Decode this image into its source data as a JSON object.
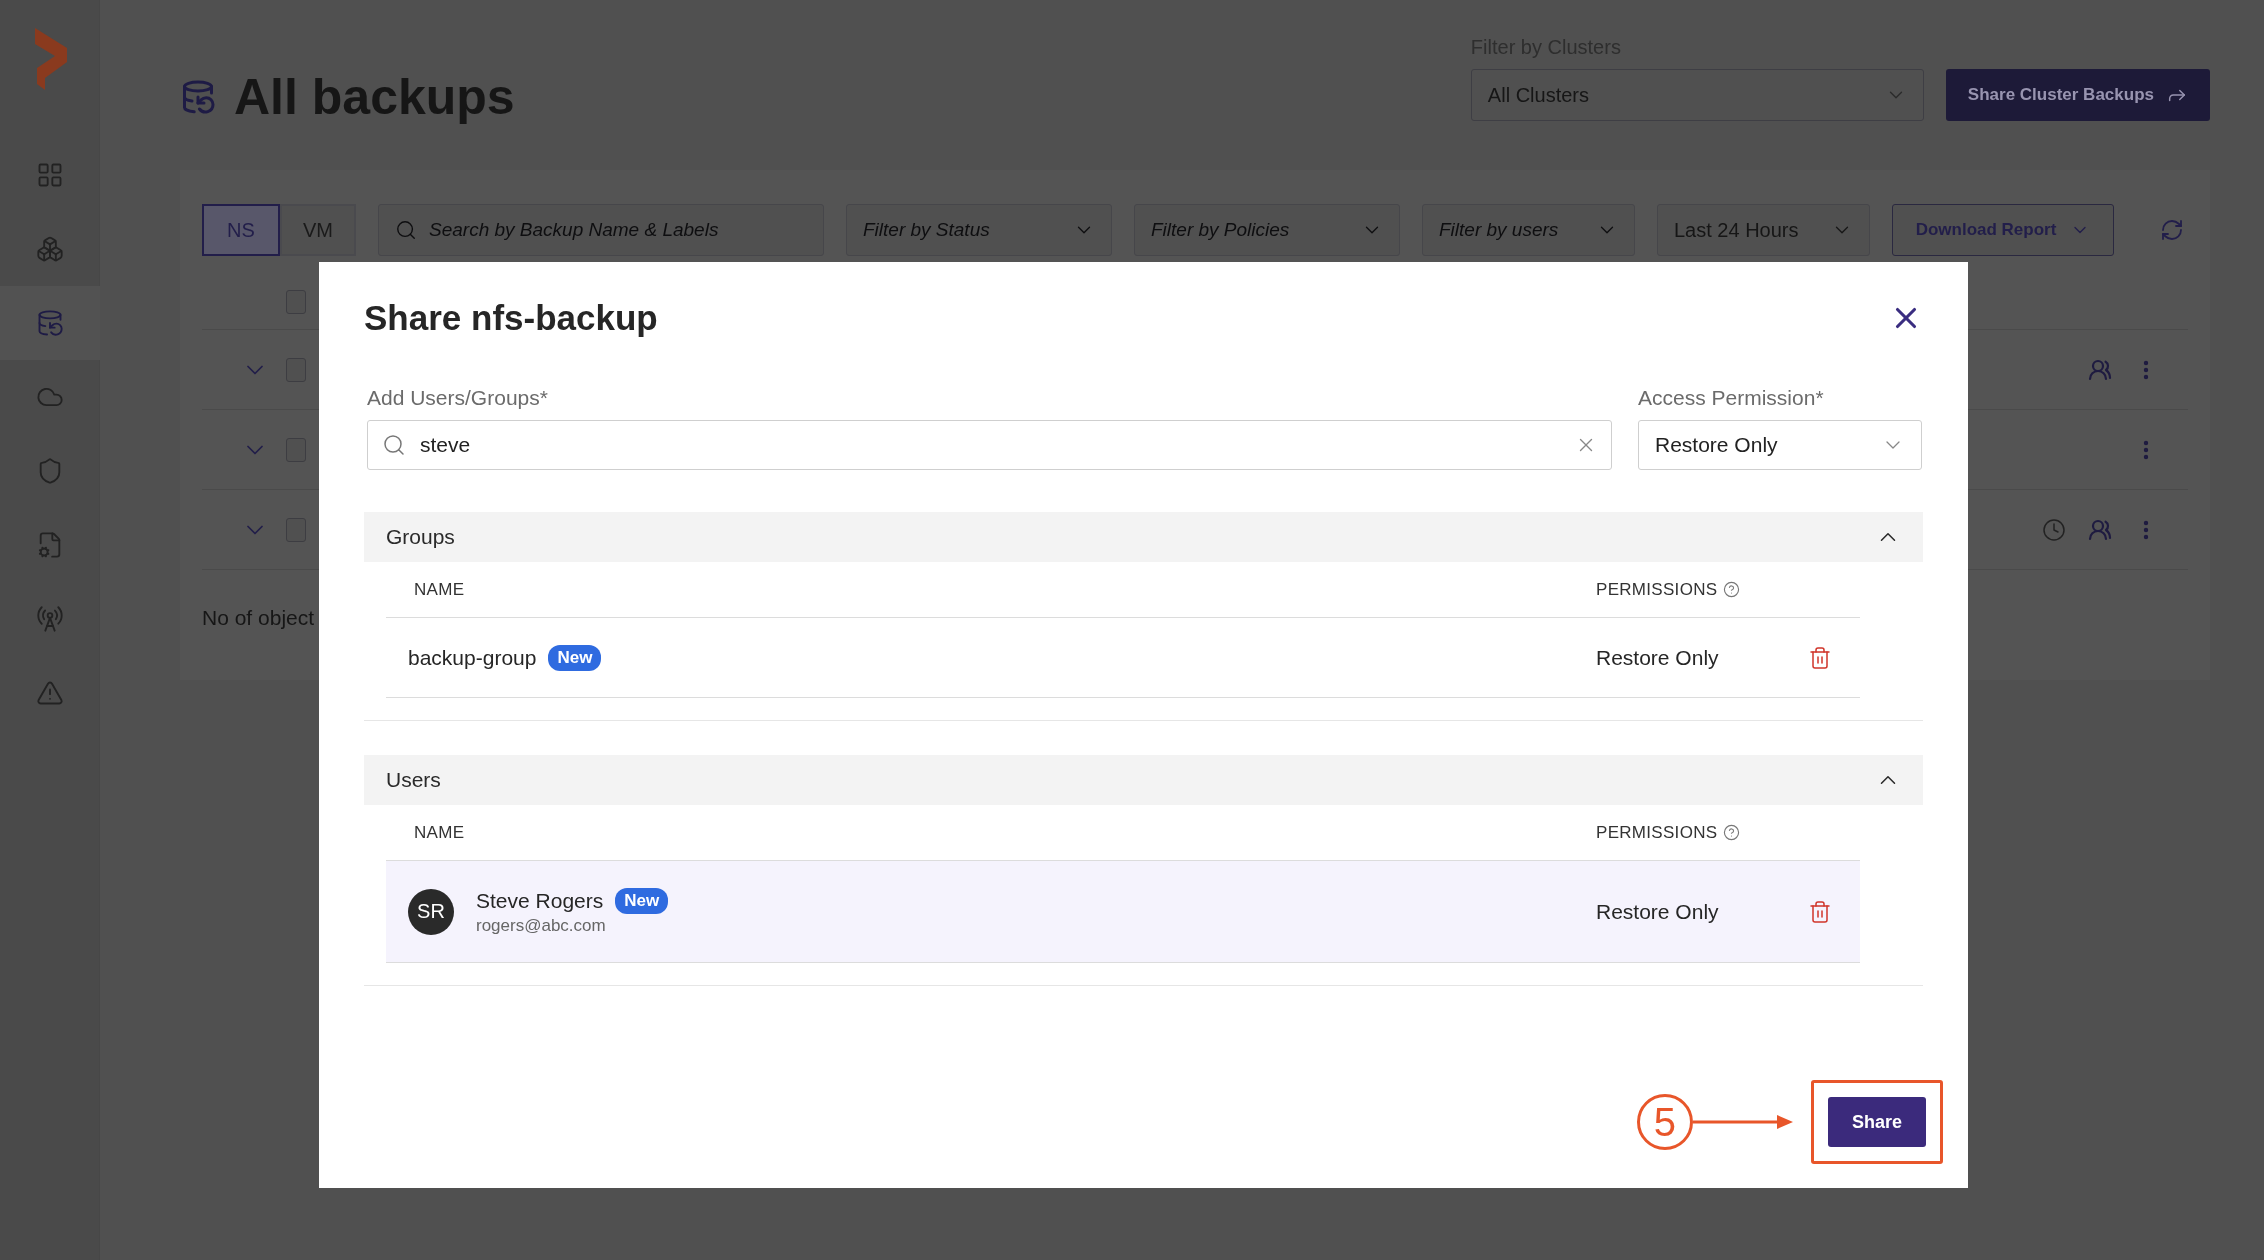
{
  "sidebar": {
    "items": [
      {
        "kind": "grid",
        "selected": false
      },
      {
        "kind": "clusters",
        "selected": false
      },
      {
        "kind": "backups",
        "selected": true
      },
      {
        "kind": "cloud",
        "selected": false
      },
      {
        "kind": "shield",
        "selected": false
      },
      {
        "kind": "policy",
        "selected": false
      },
      {
        "kind": "antenna",
        "selected": false
      },
      {
        "kind": "alert",
        "selected": false
      }
    ]
  },
  "page": {
    "title": "All backups",
    "cluster_filter": {
      "label": "Filter by Clusters",
      "value": "All Clusters"
    },
    "share_cluster_backups": "Share Cluster Backups"
  },
  "toolbar": {
    "tabs": [
      {
        "label": "NS",
        "selected": true
      },
      {
        "label": "VM",
        "selected": false
      }
    ],
    "search": {
      "placeholder": "Search by Backup Name & Labels"
    },
    "filters": [
      {
        "placeholder": "Filter by Status"
      },
      {
        "placeholder": "Filter by Policies"
      },
      {
        "placeholder": "Filter by users"
      }
    ],
    "time_range": "Last 24 Hours",
    "download_report": "Download Report"
  },
  "table": {
    "select_all": {
      "checked": false
    },
    "rows": [
      {
        "checked": false,
        "scheduled": false,
        "shared": true
      },
      {
        "checked": false,
        "scheduled": false,
        "shared": false
      },
      {
        "checked": false,
        "scheduled": true,
        "shared": true
      }
    ],
    "footer": "No of object"
  },
  "modal": {
    "title": "Share nfs-backup",
    "users_field": {
      "label": "Add Users/Groups*",
      "value": "steve"
    },
    "permission_field": {
      "label": "Access Permission*",
      "value": "Restore Only"
    },
    "sections": [
      {
        "title": "Groups",
        "expanded": true,
        "columns": [
          "NAME",
          "PERMISSIONS"
        ],
        "rows": [
          {
            "kind": "group",
            "name": "backup-group",
            "badge": "New",
            "permission": "Restore Only",
            "highlighted": false
          }
        ]
      },
      {
        "title": "Users",
        "expanded": true,
        "columns": [
          "NAME",
          "PERMISSIONS"
        ],
        "rows": [
          {
            "kind": "user",
            "initials": "SR",
            "name": "Steve Rogers",
            "email": "rogers@abc.com",
            "badge": "New",
            "permission": "Restore Only",
            "highlighted": true
          }
        ]
      }
    ],
    "share_button": "Share",
    "annotation": {
      "number": "5"
    }
  }
}
